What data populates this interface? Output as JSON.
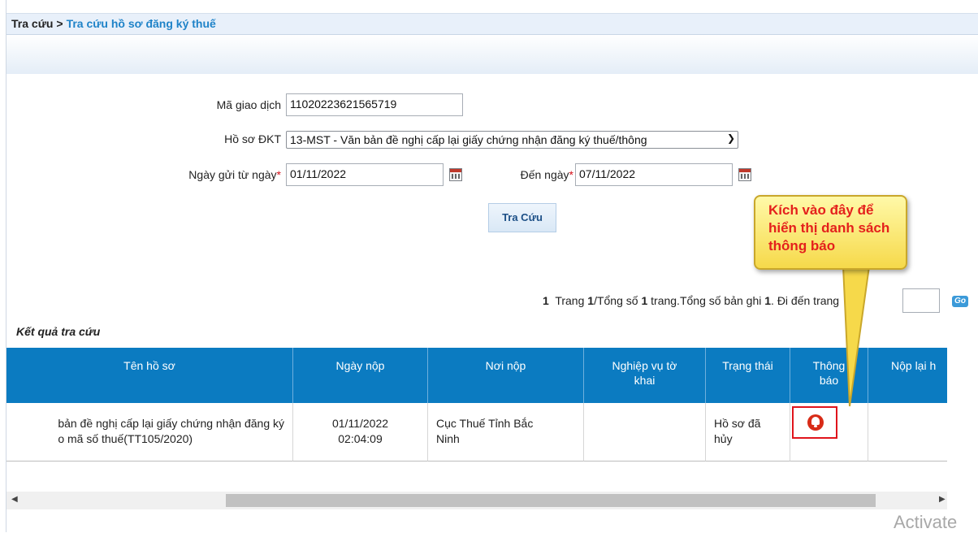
{
  "breadcrumb": {
    "root": "Tra cứu",
    "separator": ">",
    "current": "Tra cứu hồ sơ đăng ký thuế"
  },
  "form": {
    "transaction_label": "Mã giao dịch",
    "transaction_value": "11020223621565719",
    "dossier_label": "Hồ sơ ĐKT",
    "dossier_value": "13-MST - Văn bản đề nghị cấp lại giấy chứng nhận đăng ký thuế/thông",
    "from_date_label": "Ngày gửi từ ngày",
    "required_mark": "*",
    "from_date_value": "01/11/2022",
    "to_date_label": "Đến ngày",
    "to_date_value": "07/11/2022",
    "search_button": "Tra Cứu"
  },
  "pager": {
    "current_page": "1",
    "text_page": "Trang",
    "page_fraction": "1",
    "text_total_pages": "/Tổng số",
    "total_pages": "1",
    "text_records": "trang.Tổng số bản ghi",
    "total_records": "1",
    "text_goto": ". Đi đến trang",
    "go_label": "Go"
  },
  "results": {
    "title": "Kết quả tra cứu",
    "columns": [
      "Tên hồ sơ",
      "Ngày nộp",
      "Nơi nộp",
      "Nghiệp vụ tờ khai",
      "Trạng thái",
      "Thông báo",
      "Nộp lại h"
    ],
    "rows": [
      {
        "name_line1": "bản đề nghị cấp lại giấy chứng nhận đăng ký",
        "name_line2": "o mã số thuế(TT105/2020)",
        "date_line1": "01/11/2022",
        "date_line2": "02:04:09",
        "place": "Cục Thuế Tỉnh Bắc Ninh",
        "business": "",
        "status": "Hồ sơ đã hủy",
        "notification_icon": "bell-icon",
        "resubmit": ""
      }
    ]
  },
  "annotation": {
    "text": "Kích vào đây để hiển thị danh sách thông báo",
    "color": "#e4201c"
  },
  "watermark": "Activate"
}
